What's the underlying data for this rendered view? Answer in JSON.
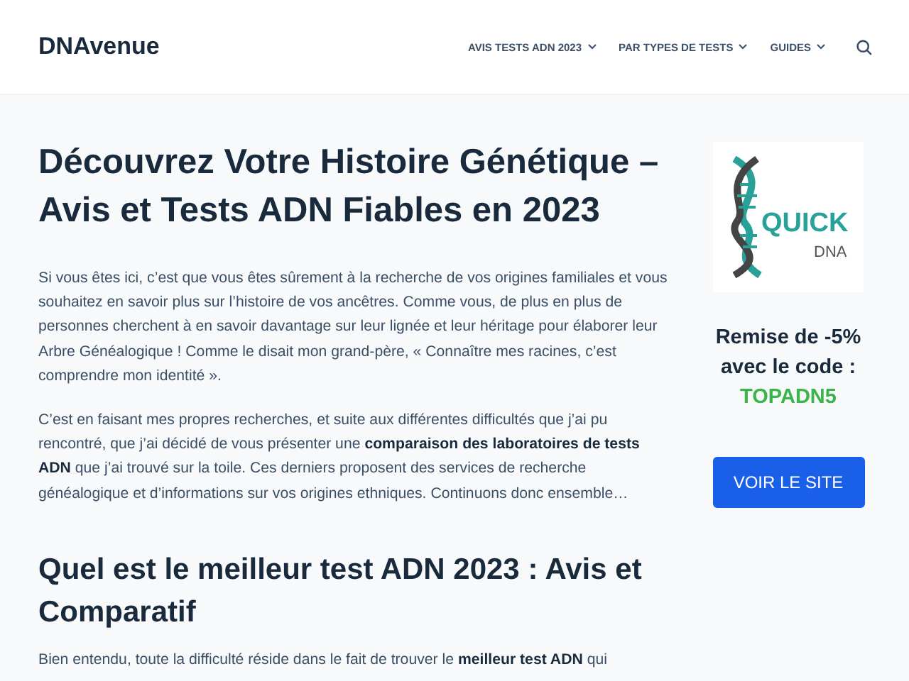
{
  "header": {
    "logo": "DNAvenue",
    "nav": [
      {
        "label": "AVIS TESTS ADN 2023",
        "has_submenu": true
      },
      {
        "label": "PAR TYPES DE TESTS",
        "has_submenu": true
      },
      {
        "label": "GUIDES",
        "has_submenu": true
      }
    ]
  },
  "article": {
    "blocks": [
      {
        "kind": "h1",
        "text": "Découvrez Votre Histoire Génétique – Avis et Tests ADN Fiables en 2023"
      },
      {
        "kind": "p",
        "text": "Si vous êtes ici, c’est que vous êtes sûrement à la recherche de vos origines familiales et vous souhaitez en savoir plus sur l’histoire de vos ancêtres. Comme vous, de plus en plus de personnes cherchent à en savoir davantage sur leur lignée et leur héritage pour élaborer leur Arbre Généalogique ! Comme le disait mon grand-père, « Connaître mes racines, c’est comprendre mon identité »."
      },
      {
        "kind": "p",
        "text": "C’est en faisant mes propres recherches, et suite aux différentes difficultés que j’ai pu rencontré, que j’ai décidé de vous présenter une **comparaison des laboratoires de tests ADN** que j’ai trouvé sur la toile. Ces derniers proposent des services de recherche généalogique et d’informations sur vos origines ethniques. Continuons donc ensemble…"
      },
      {
        "kind": "h2",
        "text": "Quel est le meilleur test ADN 2023 : Avis et Comparatif"
      },
      {
        "kind": "p",
        "text": "Bien entendu, toute la difficulté réside dans le fait de trouver le **meilleur test ADN** qui"
      }
    ]
  },
  "sidebar": {
    "logo_word": "QUICK",
    "logo_sub": "DNA",
    "promo_lines": [
      "Remise de -5%",
      "avec le code :"
    ],
    "code": "TOPADN5",
    "button": "VOIR LE SITE"
  }
}
